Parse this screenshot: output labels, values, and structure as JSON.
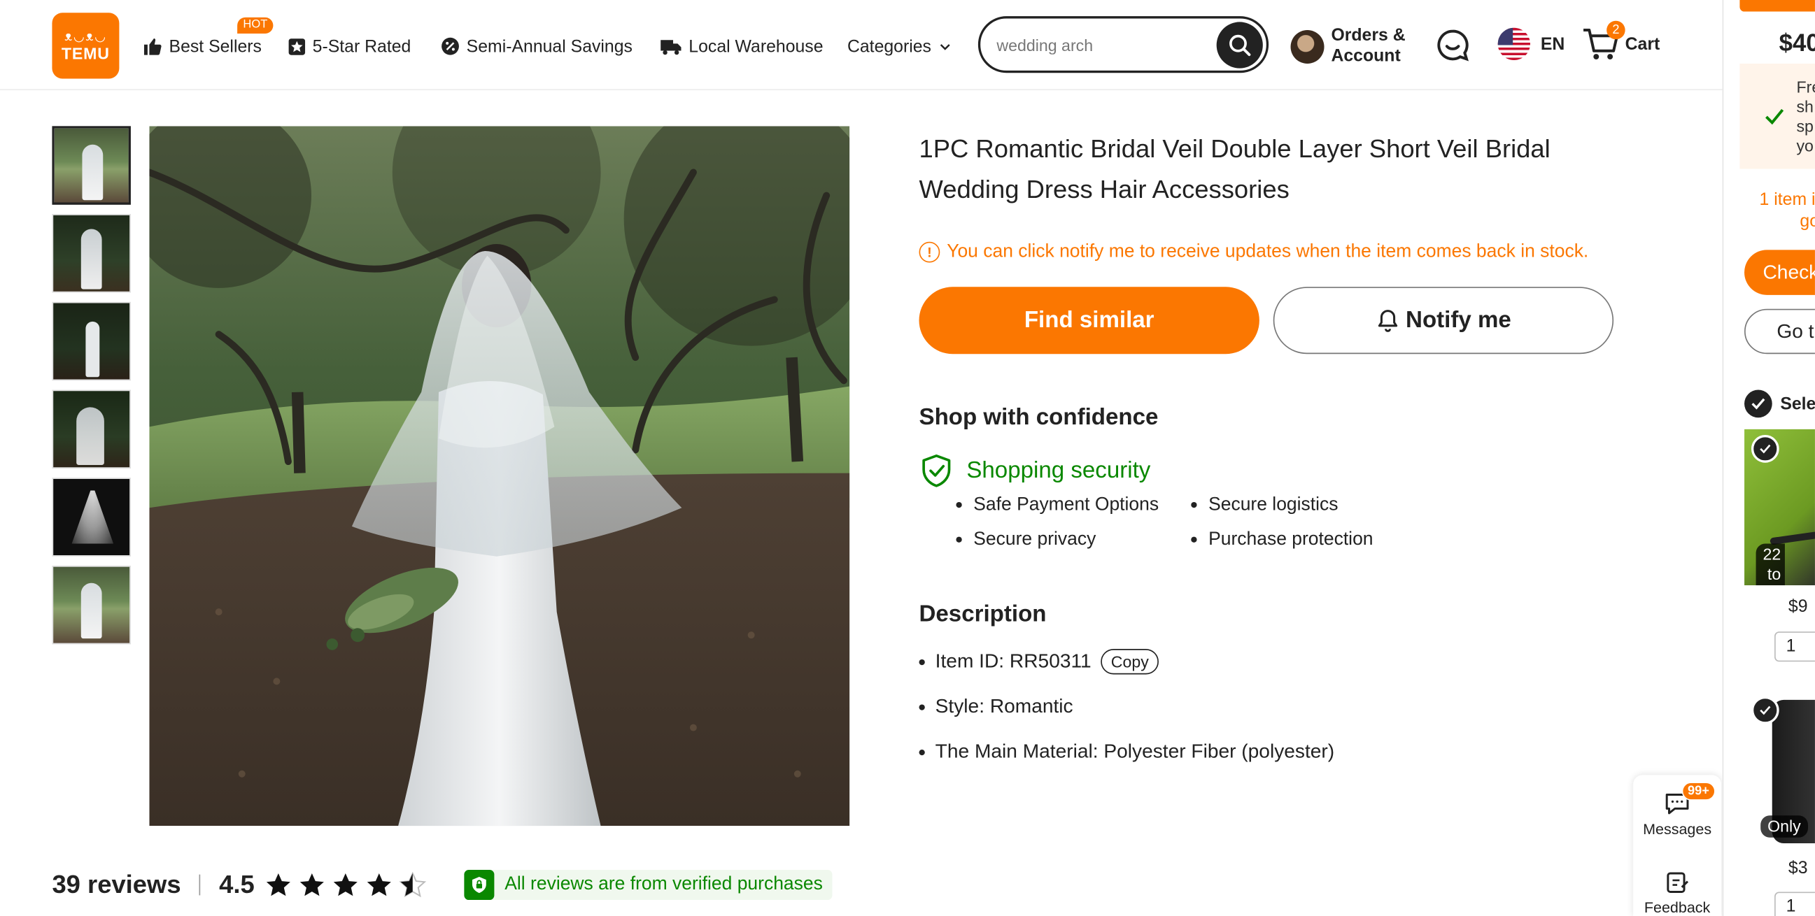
{
  "header": {
    "logo_mark": "ᴥ◡ᴥ◡",
    "logo_text": "TEMU",
    "hot_badge": "HOT",
    "nav": [
      "Best Sellers",
      "5-Star Rated",
      "Semi-Annual Savings",
      "Local Warehouse",
      "Categories"
    ],
    "search_value": "wedding arch",
    "account_line1": "Orders &",
    "account_line2": "Account",
    "language": "EN",
    "cart_label": "Cart",
    "cart_count": "2"
  },
  "product": {
    "title": "1PC Romantic Bridal Veil Double Layer Short Veil Bridal Wedding Dress Hair Accessories",
    "stock_notice": "You can click notify me to receive updates when the item comes back in stock.",
    "find_similar": "Find similar",
    "notify_me": "Notify me",
    "confidence_heading": "Shop with confidence",
    "security_label": "Shopping security",
    "security_items": [
      "Safe Payment Options",
      "Secure logistics",
      "Secure privacy",
      "Purchase protection"
    ],
    "description_heading": "Description",
    "item_id": "Item ID: RR50311",
    "copy_label": "Copy",
    "style": "Style: Romantic",
    "material": "The Main Material: Polyester Fiber (polyester)"
  },
  "reviews": {
    "count": "39 reviews",
    "score": "4.5",
    "rating": 4.5,
    "verified": "All reviews are from verified purchases"
  },
  "floating": {
    "messages_badge": "99+",
    "messages_label": "Messages",
    "feedback_label": "Feedback"
  },
  "side_panel": {
    "price": "$40",
    "shipping_lines": [
      "Fre",
      "sh",
      "sp",
      "yo"
    ],
    "items_line1": "1 item i",
    "items_line2": "go",
    "checkout": "Check",
    "goto": "Go t",
    "select": "Sele",
    "prod1_tag_line1": "22",
    "prod1_tag_line2": "to",
    "prod1_price": "$9",
    "prod1_qty": "1",
    "prod2_tag": "Only",
    "prod2_price": "$3",
    "prod2_qty": "1"
  },
  "colors": {
    "brand": "#fb7701",
    "success": "#0a8800",
    "text": "#222222"
  }
}
